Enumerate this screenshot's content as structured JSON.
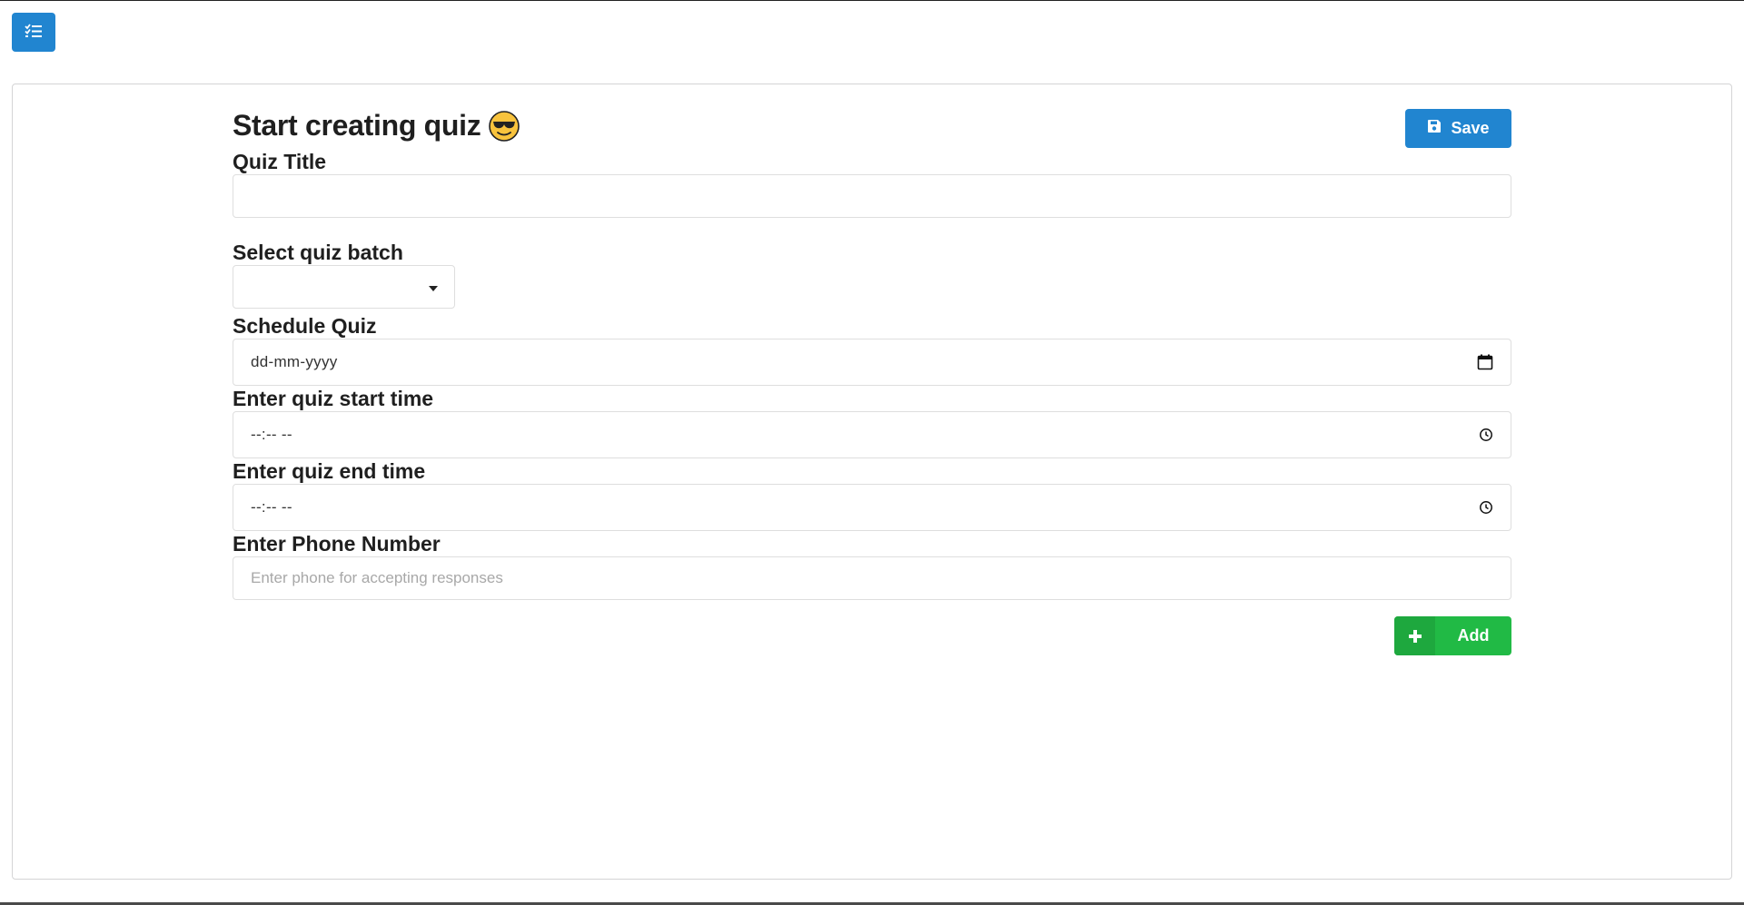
{
  "header": {
    "menu_icon": "list-checks-icon",
    "accent_color": "#2185d0"
  },
  "form": {
    "title": "Start creating quiz",
    "title_emoji": "sunglasses-face-emoji",
    "save_label": "Save",
    "save_icon": "floppy-disk-icon",
    "fields": {
      "quiz_title": {
        "label": "Quiz Title",
        "value": ""
      },
      "quiz_batch": {
        "label": "Select quiz batch",
        "value": ""
      },
      "schedule": {
        "label": "Schedule Quiz",
        "value": "dd-mm-yyyy",
        "icon": "calendar-icon"
      },
      "start_time": {
        "label": "Enter quiz start time",
        "value": "--:-- --",
        "icon": "clock-icon"
      },
      "end_time": {
        "label": "Enter quiz end time",
        "value": "--:-- --",
        "icon": "clock-icon"
      },
      "phone": {
        "label": "Enter Phone Number",
        "placeholder": "Enter phone for accepting responses"
      }
    },
    "add_label": "Add",
    "add_icon": "plus-icon",
    "add_color": "#21ba45"
  }
}
